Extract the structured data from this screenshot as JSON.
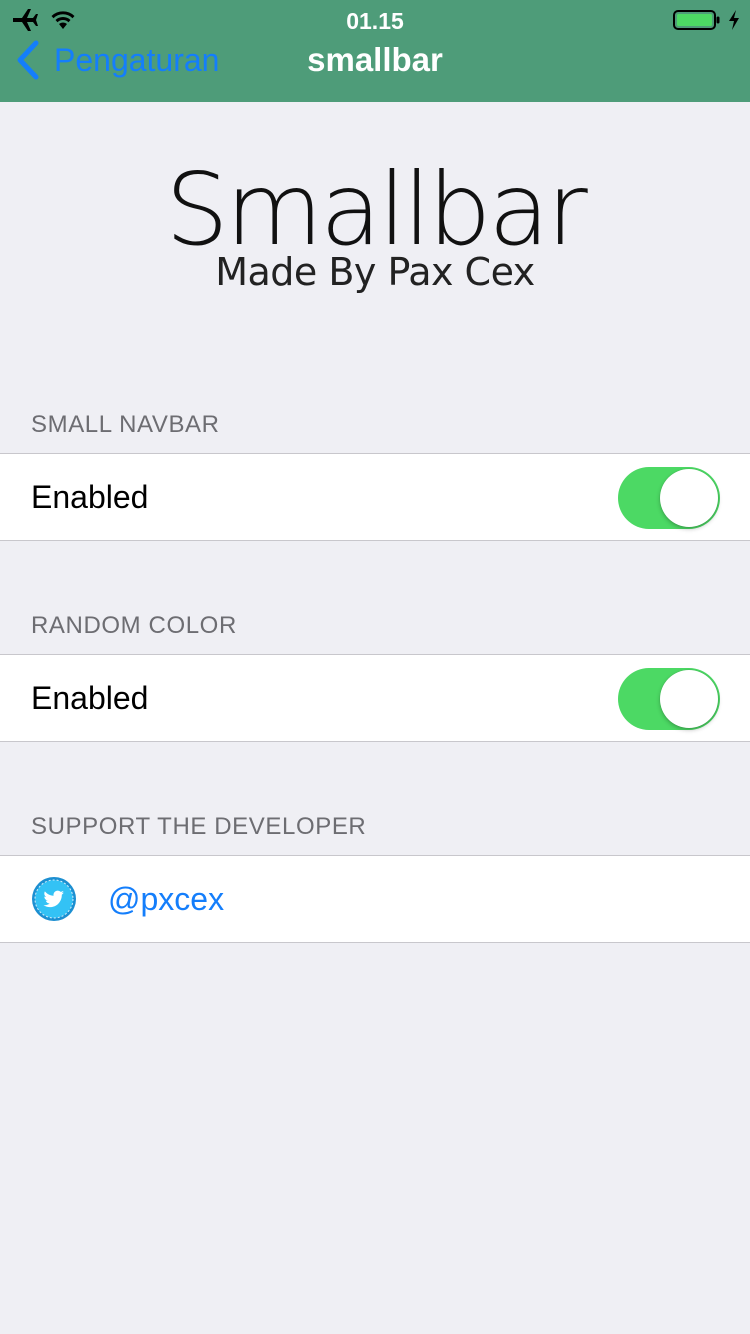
{
  "status_bar": {
    "time": "01.15",
    "icons": [
      "airplane-icon",
      "wifi-icon",
      "battery-icon",
      "charging-icon"
    ]
  },
  "nav": {
    "back_label": "Pengaturan",
    "title": "smallbar",
    "bar_color": "#4e9c79"
  },
  "header": {
    "title": "Smallbar",
    "subtitle": "Made By Pax Cex"
  },
  "sections": {
    "small_navbar": {
      "header": "SMALL NAVBAR",
      "label": "Enabled",
      "switch_on": true
    },
    "random_color": {
      "header": "RANDOM COLOR",
      "label": "Enabled",
      "switch_on": true
    },
    "support": {
      "header": "SUPPORT THE DEVELOPER",
      "handle": "@pxcex",
      "icon": "twitter-icon"
    }
  },
  "colors": {
    "accent": "#147efb",
    "switch_on": "#4cd964",
    "background": "#efeff4"
  }
}
